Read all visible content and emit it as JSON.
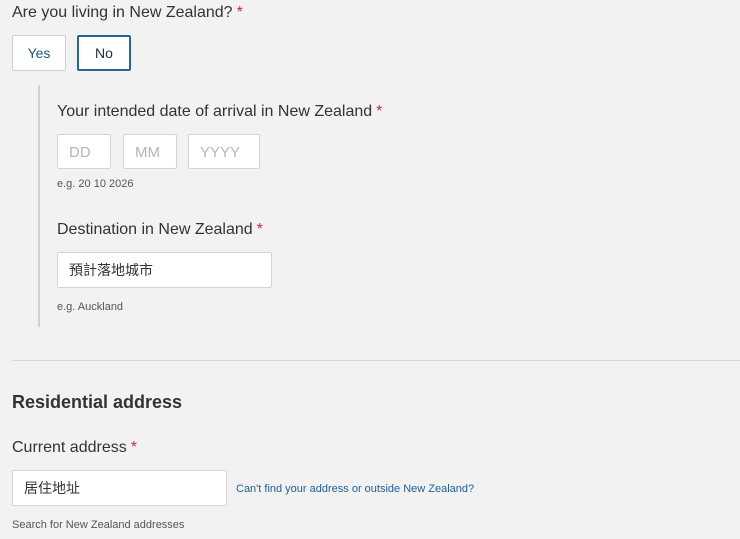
{
  "living_question": {
    "label": "Are you living in New Zealand?",
    "required_mark": "*",
    "yes_label": "Yes",
    "no_label": "No",
    "selected": "No"
  },
  "arrival": {
    "label": "Your intended date of arrival in New Zealand",
    "required_mark": "*",
    "day_placeholder": "DD",
    "month_placeholder": "MM",
    "year_placeholder": "YYYY",
    "hint": "e.g. 20 10 2026"
  },
  "destination": {
    "label": "Destination in New Zealand",
    "required_mark": "*",
    "value": "預計落地城市",
    "hint": "e.g. Auckland"
  },
  "residential": {
    "section_title": "Residential address",
    "current_label": "Current address",
    "required_mark": "*",
    "value": "居住地址",
    "link": "Can't find your address or outside New Zealand?",
    "hint": "Search for New Zealand addresses"
  },
  "colors": {
    "background": "#f2f2f2",
    "accent": "#2a6496",
    "required": "#cc2a36",
    "link": "#1f5f99"
  }
}
